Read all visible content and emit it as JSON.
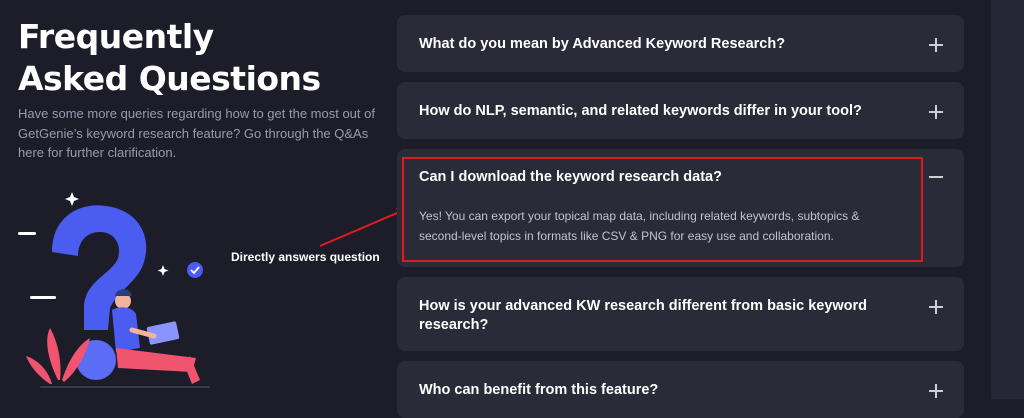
{
  "header": {
    "title_line1": "Frequently",
    "title_line2": "Asked Questions",
    "description": "Have some more queries regarding how to get the most out of GetGenie’s keyword research feature? Go through the Q&As here for further clarification."
  },
  "annotation": {
    "label": "Directly answers question",
    "color": "#e01b1b"
  },
  "faq": {
    "items": [
      {
        "question": "What do you mean by Advanced Keyword Research?",
        "expanded": false,
        "icon": "plus-icon"
      },
      {
        "question": "How do NLP, semantic, and related keywords differ in your tool?",
        "expanded": false,
        "icon": "plus-icon"
      },
      {
        "question": "Can I download the keyword research data?",
        "expanded": true,
        "icon": "minus-icon",
        "answer": "Yes! You can export your topical map data, including related keywords, subtopics & second-level topics in formats like CSV & PNG for easy use and collaboration."
      },
      {
        "question": "How is your advanced KW research different from basic keyword research?",
        "expanded": false,
        "icon": "plus-icon"
      },
      {
        "question": "Who can benefit from this feature?",
        "expanded": false,
        "icon": "plus-icon"
      }
    ]
  },
  "colors": {
    "background": "#1d1d2a",
    "card": "#2a2a38",
    "accent_blue": "#4b5cf0",
    "accent_pink": "#f0546e"
  }
}
